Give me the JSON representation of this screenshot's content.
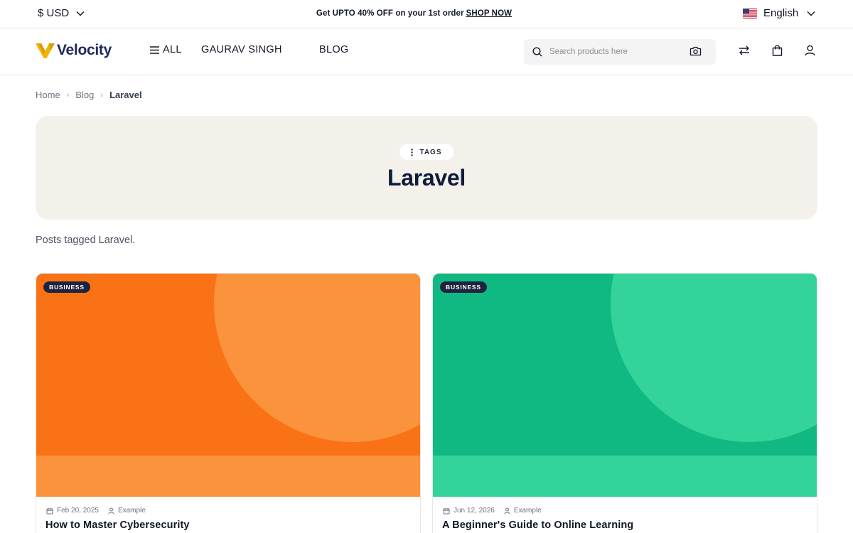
{
  "topbar": {
    "currency": "$ USD",
    "promo_text": "Get UPTO 40% OFF on your 1st order",
    "promo_link": "SHOP NOW",
    "language": "English"
  },
  "header": {
    "logo_text": "Velocity",
    "nav": {
      "all": "ALL",
      "gaurav": "GAURAV SINGH",
      "blog": "BLOG"
    },
    "search_placeholder": "Search products here"
  },
  "breadcrumb": {
    "home": "Home",
    "blog": "Blog",
    "current": "Laravel"
  },
  "hero": {
    "pill": "TAGS",
    "title": "Laravel"
  },
  "intro": "Posts tagged Laravel.",
  "posts": [
    {
      "category": "BUSINESS",
      "date": "Feb 20, 2025",
      "author": "Example",
      "title": "How to Master Cybersecurity",
      "colors": {
        "base": "#f97316",
        "light": "#fb923c"
      }
    },
    {
      "category": "BUSINESS",
      "date": "Jun 12, 2026",
      "author": "Example",
      "title": "A Beginner's Guide to Online Learning",
      "colors": {
        "base": "#10b981",
        "light": "#34d399"
      }
    }
  ],
  "colors": {
    "brand_navy": "#1e2a5a",
    "logo_yellow": "#f5b301",
    "hero_bg": "#f3f1ea",
    "badge_bg": "#1e2440"
  },
  "icons": [
    "chevron-down-icon",
    "us-flag-icon",
    "menu-icon",
    "search-icon",
    "camera-icon",
    "compare-icon",
    "bag-icon",
    "user-icon",
    "chevron-right-icon",
    "dots-vertical-icon",
    "calendar-icon"
  ]
}
